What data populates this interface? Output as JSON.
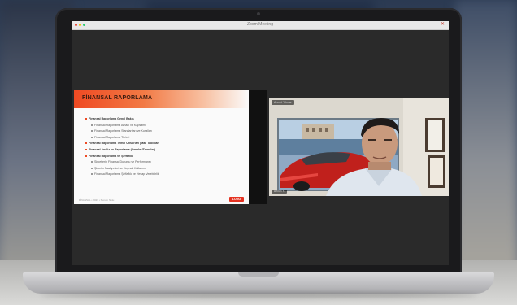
{
  "window": {
    "title": "Zoom Meeting"
  },
  "slide": {
    "title": "FİNANSAL RAPORLAMA",
    "items": [
      {
        "level": 1,
        "text": "Finansal Raporlama Genel Bakış"
      },
      {
        "level": 2,
        "text": "Finansal Raporlama Amacı ve Kapsamı"
      },
      {
        "level": 2,
        "text": "Finansal Raporlama Standartları ve Kuralları"
      },
      {
        "level": 2,
        "text": "Finansal Raporlama Türleri"
      },
      {
        "level": 1,
        "text": "Finansal Raporlama Temel Unsurları (Mali Tablolar)"
      },
      {
        "level": 1,
        "text": "Finansal Analiz ve Raporlama (Oranlar/Trendler)"
      },
      {
        "level": 1,
        "text": "Finansal Raporlama ve Şeffaflık"
      },
      {
        "level": 2,
        "text": "Şirketlerin Finansal Durumu ve Performansı"
      },
      {
        "level": 2,
        "text": "Şirketin Faaliyetleri ve Kaynak Kullanımı"
      },
      {
        "level": 2,
        "text": "Finansal Raporlama Şeffaflık ve Hesap Verebilirlik"
      }
    ],
    "footer": "FİNANSAL • 2023 • Sunum Notu",
    "logo": "LOGO"
  },
  "camera": {
    "label": "Ahmet Yılmaz",
    "name": "Ahmet Y."
  },
  "colors": {
    "accent": "#ef4a23",
    "screen_bg": "#2a2a2a"
  }
}
